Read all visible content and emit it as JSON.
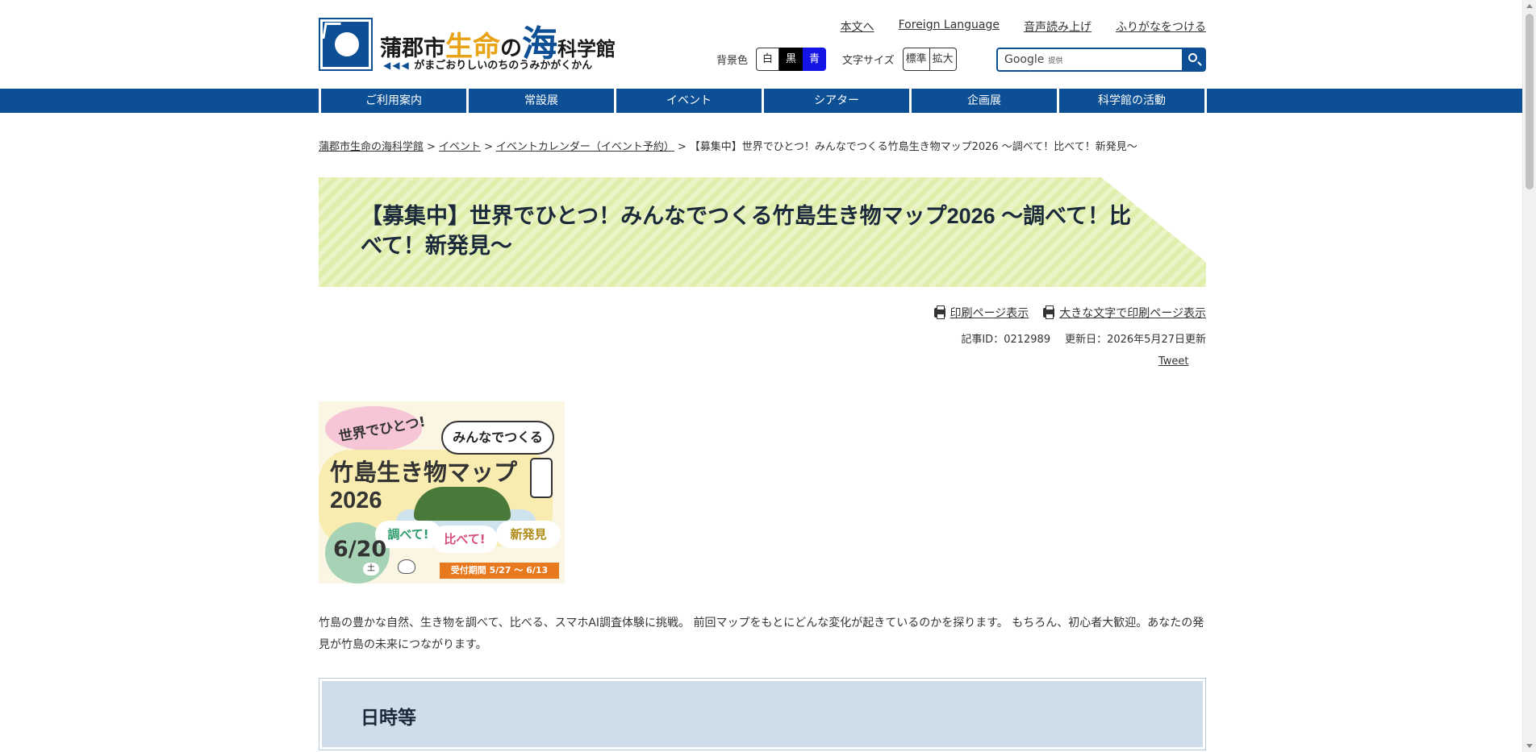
{
  "header": {
    "logo_title_part1": "蒲郡市",
    "logo_title_part2": "生命",
    "logo_title_part3": "の",
    "logo_title_part4": "海",
    "logo_title_part5": "科学館",
    "logo_subtitle_arrows": "◀◀◀",
    "logo_subtitle": "がまごおりしいのちのうみかがくかん",
    "top_links": [
      "本文へ",
      "Foreign Language",
      "音声読み上げ",
      "ふりがなをつける"
    ],
    "bg_color_label": "背景色",
    "bg_white": "白",
    "bg_black": "黒",
    "bg_blue": "青",
    "font_size_label": "文字サイズ",
    "font_standard": "標準",
    "font_large": "拡大",
    "search_brand": "Google",
    "search_brand_suffix": "提供"
  },
  "nav": {
    "items": [
      "ご利用案内",
      "常設展",
      "イベント",
      "シアター",
      "企画展",
      "科学館の活動"
    ]
  },
  "breadcrumb": {
    "items": [
      "蒲郡市生命の海科学館",
      "イベント",
      "イベントカレンダー（イベント予約）"
    ],
    "separator": ">",
    "current": "【募集中】世界でひとつ！みんなでつくる竹島生き物マップ2026 ～調べて！比べて！新発見～"
  },
  "page": {
    "title": "【募集中】世界でひとつ！みんなでつくる竹島生き物マップ2026 ～調べて！比べて！新発見～",
    "print_link": "印刷ページ表示",
    "print_large_link": "大きな文字で印刷ページ表示",
    "article_id": "記事ID：0212989",
    "updated": "更新日：2026年5月27日更新",
    "tweet": "Tweet",
    "description": "竹島の豊かな自然、生き物を調べて、比べる、スマホAI調査体験に挑戦。 前回マップをもとにどんな変化が起きているのかを探ります。 もちろん、初心者大歓迎。あなたの発見が竹島の未来につながります。",
    "section_heading": "日時等"
  },
  "flyer": {
    "catch1": "世界でひとつ!",
    "catch2": "みんなでつくる",
    "title_line1": "竹島生き物マップ",
    "title_line2": "2026",
    "date": "6/20",
    "weekday": "土",
    "pill1": "調べて!",
    "pill2": "比べて!",
    "pill3": "新発見",
    "period": "受付期間 5/27 ～ 6/13"
  },
  "colors": {
    "brand_blue": "#0c4f94",
    "banner_green": "#dfeeaa",
    "section_bg": "#cfdce9",
    "logo_accent": "#e8a317"
  }
}
